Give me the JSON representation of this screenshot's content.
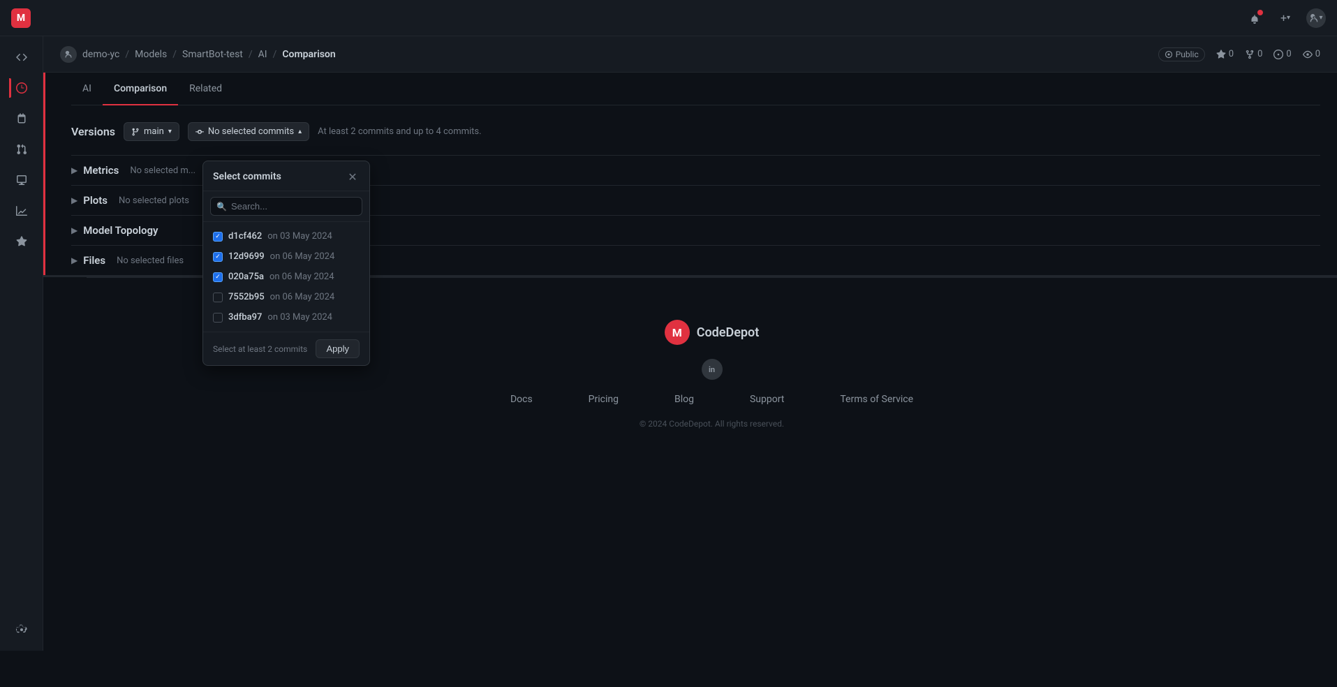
{
  "app": {
    "logo_letter": "M"
  },
  "topnav": {
    "plus_label": "+",
    "chevron_label": "▾"
  },
  "breadcrumb": {
    "org": "demo-yc",
    "models": "Models",
    "repo": "SmartBot-test",
    "section": "AI",
    "page": "Comparison",
    "separator": "/",
    "public_label": "Public",
    "stars_count": "0",
    "forks_count": "0",
    "issues_count": "0",
    "watchers_count": "0"
  },
  "tabs": [
    {
      "id": "ai",
      "label": "AI"
    },
    {
      "id": "comparison",
      "label": "Comparison"
    },
    {
      "id": "related",
      "label": "Related"
    }
  ],
  "versions": {
    "title": "Versions",
    "branch_label": "main",
    "commits_label": "No selected commits",
    "hint_text": "At least 2 commits and up to 4 commits."
  },
  "select_commits_modal": {
    "title": "Select commits",
    "search_placeholder": "Search...",
    "commits": [
      {
        "id": "d1cf462",
        "date": "on 03 May 2024",
        "checked": true
      },
      {
        "id": "12d9699",
        "date": "on 06 May 2024",
        "checked": true
      },
      {
        "id": "020a75a",
        "date": "on 06 May 2024",
        "checked": true
      },
      {
        "id": "7552b95",
        "date": "on 06 May 2024",
        "checked": false
      },
      {
        "id": "3dfba97",
        "date": "on 03 May 2024",
        "checked": false
      }
    ],
    "footer_hint": "Select at least 2 commits",
    "apply_label": "Apply"
  },
  "sections": [
    {
      "id": "metrics",
      "title": "Metrics",
      "subtitle": "No selected m..."
    },
    {
      "id": "plots",
      "title": "Plots",
      "subtitle": "No selected plots"
    },
    {
      "id": "model_topology",
      "title": "Model Topology",
      "subtitle": ""
    },
    {
      "id": "files",
      "title": "Files",
      "subtitle": "No selected files"
    }
  ],
  "footer": {
    "logo_label": "CodeDepot",
    "links": [
      "Docs",
      "Pricing",
      "Blog",
      "Support",
      "Terms of Service"
    ],
    "copyright": "© 2024 CodeDepot. All rights reserved.",
    "social": [
      "in"
    ]
  }
}
